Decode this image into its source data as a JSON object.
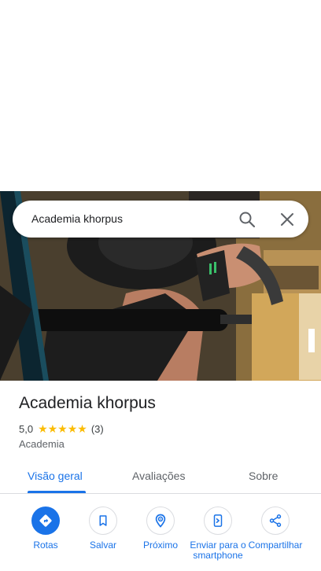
{
  "search": {
    "query": "Academia khorpus"
  },
  "place": {
    "name": "Academia khorpus",
    "rating": "5,0",
    "stars": "★★★★★",
    "review_count": "(3)",
    "category": "Academia"
  },
  "tabs": [
    {
      "label": "Visão geral",
      "active": true
    },
    {
      "label": "Avaliações",
      "active": false
    },
    {
      "label": "Sobre",
      "active": false
    }
  ],
  "actions": [
    {
      "label": "Rotas",
      "icon": "directions-icon"
    },
    {
      "label": "Salvar",
      "icon": "bookmark-icon"
    },
    {
      "label": "Próximo",
      "icon": "nearby-icon"
    },
    {
      "label": "Enviar para o smartphone",
      "icon": "send-to-phone-icon"
    },
    {
      "label": "Compartilhar",
      "icon": "share-icon"
    }
  ],
  "colors": {
    "accent": "#1a73e8",
    "star": "#fbbc04"
  }
}
